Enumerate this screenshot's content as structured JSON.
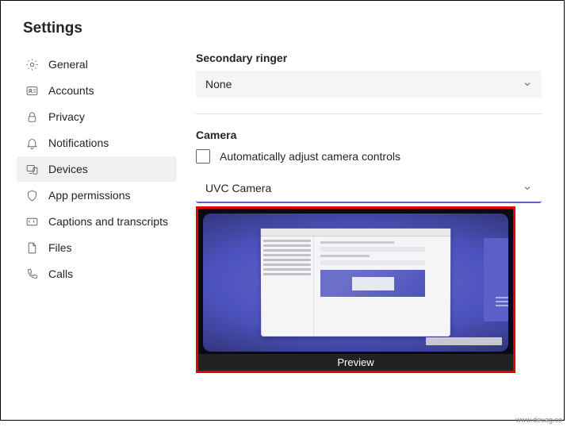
{
  "title": "Settings",
  "sidebar": {
    "items": [
      {
        "label": "General"
      },
      {
        "label": "Accounts"
      },
      {
        "label": "Privacy"
      },
      {
        "label": "Notifications"
      },
      {
        "label": "Devices"
      },
      {
        "label": "App permissions"
      },
      {
        "label": "Captions and transcripts"
      },
      {
        "label": "Files"
      },
      {
        "label": "Calls"
      }
    ]
  },
  "ringer": {
    "heading": "Secondary ringer",
    "value": "None"
  },
  "camera": {
    "heading": "Camera",
    "auto_label": "Automatically adjust camera controls",
    "value": "UVC Camera",
    "preview_label": "Preview"
  },
  "watermark": "www.deuag.co"
}
